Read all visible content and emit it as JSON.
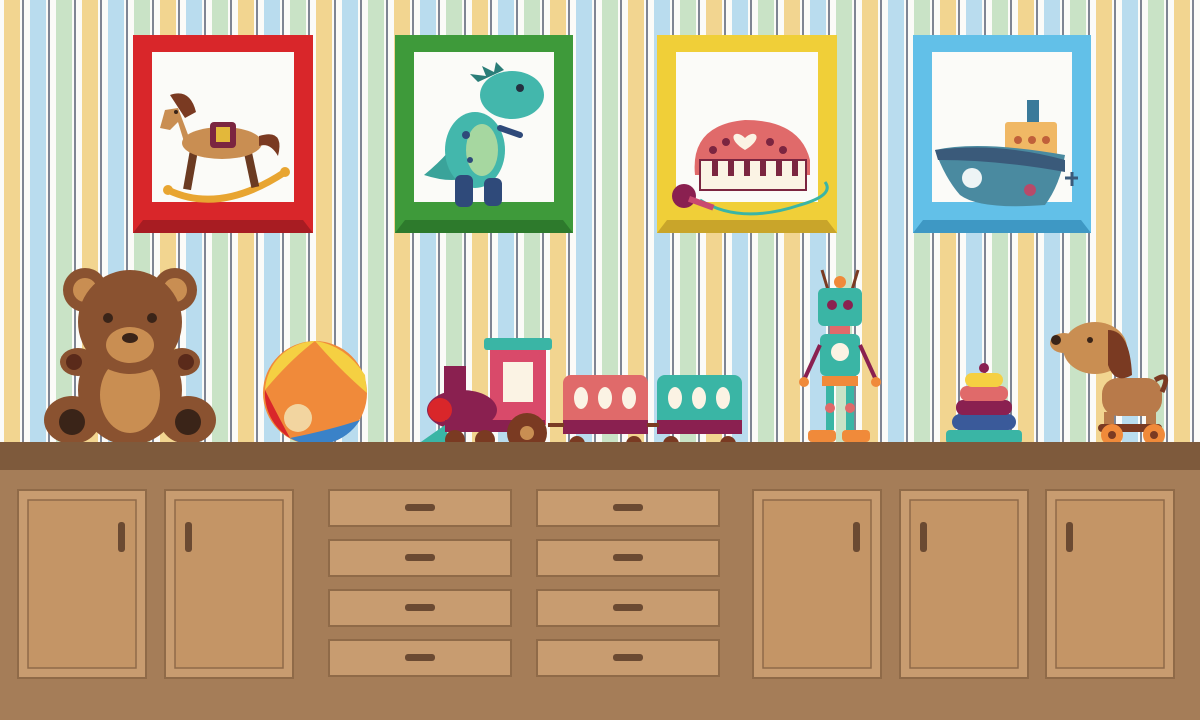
{
  "palette": {
    "wall_bg": "#fbfbf8",
    "wall_stripes": [
      "#f2d590",
      "#b9dcee",
      "#c9e3c6"
    ],
    "pinstripe": "#7f8593",
    "countertop": "#7e5a3c",
    "cabinet_body": "#a57d58",
    "cabinet_door": "#c89c70",
    "door_panel": "#c49566",
    "cabinet_outline": "#8f6a48",
    "handle": "#6b4a32"
  },
  "shelves": [
    {
      "frame_color": "#d9262a",
      "frame_dark": "#a81c22",
      "toy": "rocking-horse"
    },
    {
      "frame_color": "#3e9a3a",
      "frame_dark": "#2d7a2c",
      "toy": "dinosaur"
    },
    {
      "frame_color": "#f0cf38",
      "frame_dark": "#c9a52a",
      "toy": "toy-piano"
    },
    {
      "frame_color": "#62c0e8",
      "frame_dark": "#3e98c4",
      "toy": "toy-boat"
    }
  ],
  "counter_toys": [
    "teddy-bear",
    "beach-ball",
    "toy-train",
    "robot",
    "stacking-rings",
    "pull-along-dog"
  ],
  "cabinet": {
    "left_doors": 2,
    "drawer_columns": 2,
    "drawers_per_column": 4,
    "right_doors": 3
  }
}
